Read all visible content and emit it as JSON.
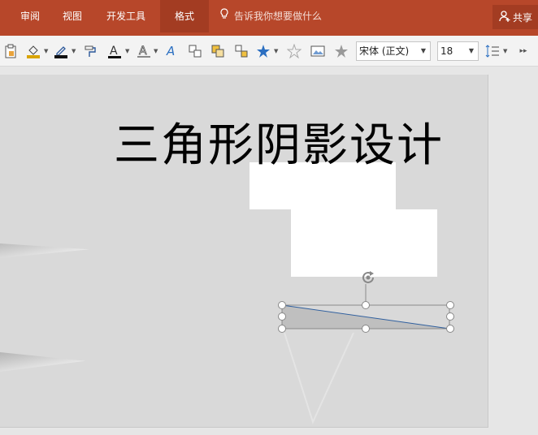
{
  "ribbon": {
    "tabs": [
      {
        "label": "审阅"
      },
      {
        "label": "视图"
      },
      {
        "label": "开发工具"
      },
      {
        "label": "格式",
        "active": true
      }
    ],
    "tell_me": "告诉我你想要做什么",
    "share": "共享"
  },
  "toolbar": {
    "font_name": "宋体 (正文)",
    "font_size": "18",
    "icons": [
      "clipboard-icon",
      "fill-color-icon",
      "line-color-icon",
      "format-painter-icon",
      "font-color-icon",
      "text-outline-icon",
      "text-effects-icon",
      "arrange-icon",
      "group-icon",
      "align-icon",
      "star-shape-icon",
      "star-outline-icon",
      "picture-icon",
      "star-icon",
      "line-spacing-icon",
      "more-icon"
    ]
  },
  "slide": {
    "title": "三角形阴影设计"
  },
  "colors": {
    "ribbon": "#b7472a",
    "ribbon_active": "#a33c22",
    "slide_bg": "#d9d9d9"
  }
}
